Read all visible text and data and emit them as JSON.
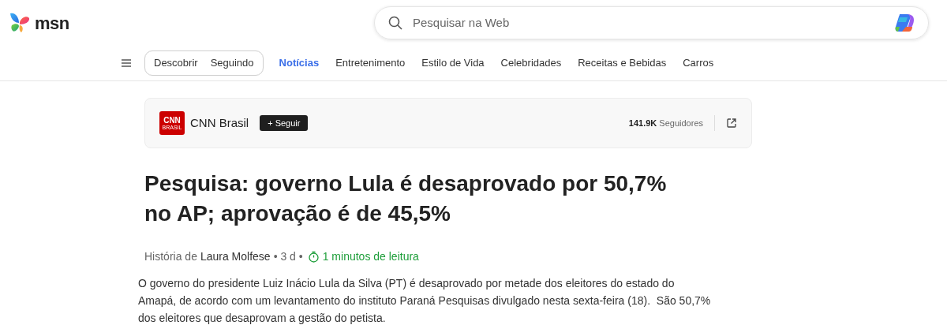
{
  "brand": {
    "name": "msn"
  },
  "search": {
    "placeholder": "Pesquisar na Web"
  },
  "feed_toggle": [
    {
      "label": "Descobrir",
      "selected": false
    },
    {
      "label": "Seguindo",
      "selected": false
    }
  ],
  "nav": [
    {
      "label": "Notícias",
      "selected": true
    },
    {
      "label": "Entretenimento",
      "selected": false
    },
    {
      "label": "Estilo de Vida",
      "selected": false
    },
    {
      "label": "Celebridades",
      "selected": false
    },
    {
      "label": "Receitas e Bebidas",
      "selected": false
    },
    {
      "label": "Carros",
      "selected": false
    }
  ],
  "publisher": {
    "logo_text": "CNN",
    "logo_subtext": "BRASIL",
    "name": "CNN Brasil",
    "follow_label": "+ Seguir",
    "followers_count": "141.9K",
    "followers_label": "Seguidores"
  },
  "article": {
    "title": "Pesquisa: governo Lula é desaprovado por 50,7% no AP; aprovação é de 45,5%",
    "byline": {
      "prefix": "História de",
      "author": "Laura Molfese",
      "age": "• 3 d •",
      "read_time": "1 minutos de leitura"
    },
    "body": "O governo do presidente Luiz Inácio Lula da Silva (PT) é desaprovado por metade dos eleitores do estado do Amapá, de acordo com um levantamento do instituto Paraná Pesquisas divulgado nesta sexta-feira (18).  São 50,7% dos eleitores que desaprovam a gestão do petista."
  }
}
